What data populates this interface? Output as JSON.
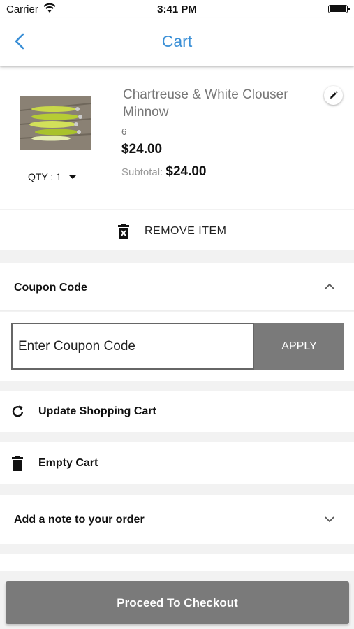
{
  "status_bar": {
    "carrier": "Carrier",
    "time": "3:41 PM",
    "icons": [
      "wifi-icon",
      "battery-icon"
    ]
  },
  "header": {
    "back_icon": "chevron-left-icon",
    "title": "Cart"
  },
  "cart_item": {
    "name": "Chartreuse & White Clouser Minnow",
    "image": "fly-lure-product-photo",
    "sku": "6",
    "price": "$24.00",
    "subtotal_label": "Subtotal:",
    "subtotal_value": "$24.00",
    "qty_label": "QTY : 1",
    "edit_icon": "pencil-icon"
  },
  "remove_item": {
    "label": "REMOVE ITEM",
    "icon": "trash-x-icon"
  },
  "coupon": {
    "heading": "Coupon Code",
    "expanded": true,
    "placeholder": "Enter Coupon Code",
    "apply_label": "APPLY"
  },
  "actions": {
    "update_label": "Update Shopping Cart",
    "update_icon": "refresh-icon",
    "empty_label": "Empty Cart",
    "empty_icon": "trash-icon"
  },
  "note": {
    "label": "Add a note to your order",
    "expanded": false
  },
  "checkout": {
    "label": "Proceed To Checkout"
  },
  "colors": {
    "accent": "#3a8fd6",
    "button_gray": "#7a7a7a",
    "background": "#f2f2f2"
  }
}
